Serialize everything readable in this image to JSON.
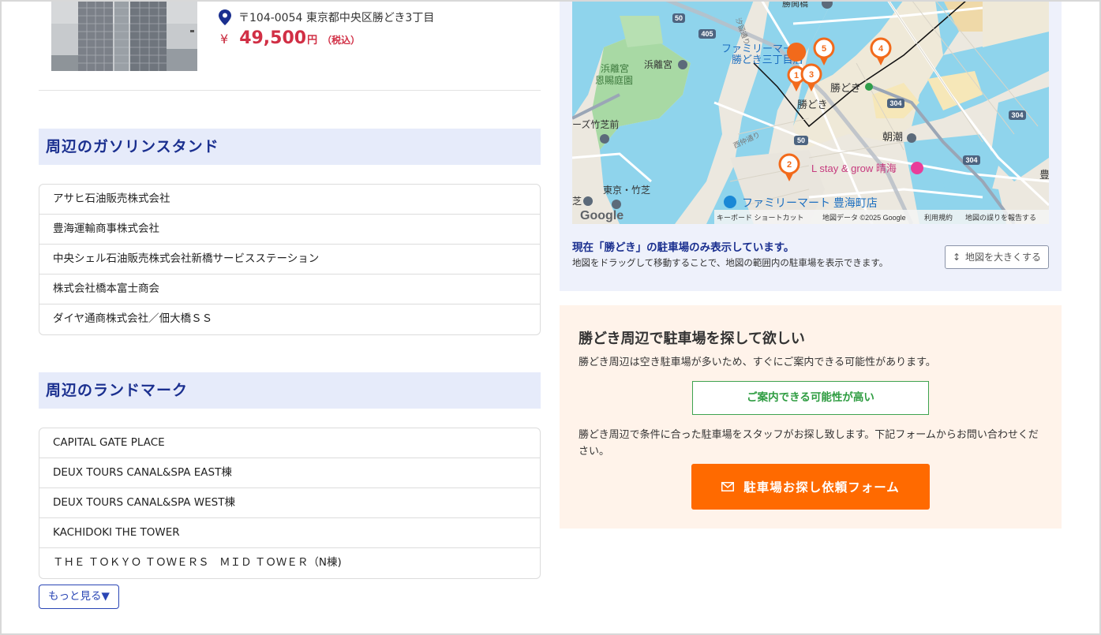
{
  "listing": {
    "address": "〒104-0054 東京都中央区勝どき3丁目",
    "yen_symbol": "¥",
    "price": "49,500",
    "price_unit": "円",
    "tax_note": "（税込）"
  },
  "gas_stations": {
    "heading": "周辺のガソリンスタンド",
    "items": [
      "アサヒ石油販売株式会社",
      "豊海運輸商事株式会社",
      "中央シェル石油販売株式会社新橋サービスステーション",
      "株式会社橋本富士商会",
      "ダイヤ通商株式会社／佃大橋ＳＳ"
    ]
  },
  "landmarks": {
    "heading": "周辺のランドマーク",
    "items": [
      "CAPITAL GATE PLACE",
      "DEUX TOURS CANAL&SPA EAST棟",
      "DEUX TOURS CANAL&SPA WEST棟",
      "KACHIDOKI THE TOWER",
      "ＴＨＥ ＴＯＫＹＯ ＴＯＷＥＲＳ　ＭＩＤ ＴＯＷＥＲ（N棟)"
    ],
    "more_label": "もっと見る▼"
  },
  "map": {
    "labels": {
      "hamarikyu": "浜離宮",
      "hamarikyu_garden_1": "浜離宮",
      "hamarikyu_garden_2": "恩賜庭園",
      "familymart_kachidoki_1": "ファミリーマート",
      "familymart_kachidoki_2": "勝どき三丁目店",
      "kachidoki_station": "勝どき",
      "kachidoki_area": "勝どき",
      "asashio": "朝潮",
      "takeshiba_mae": "ーズ竹芝前",
      "tokyo_takeshiba": "東京・竹芝",
      "lstay": "L stay & grow 晴海",
      "familymart_toyomi": "ファミリーマート 豊海町店",
      "kachidoki_bridge": "勝鬨橋",
      "shioji_road": "汐留通り",
      "nishinaka_road": "西仲通り",
      "shio": "芝",
      "toyo": "豊",
      "route_50a": "50",
      "route_50b": "50",
      "route_405": "405",
      "route_304a": "304",
      "route_304b": "304",
      "route_304c": "304"
    },
    "markers": [
      "1",
      "2",
      "3",
      "4",
      "5"
    ],
    "google_logo": "Google",
    "attribution": {
      "shortcuts": "キーボード ショートカット",
      "data": "地図データ ©2025 Google",
      "terms": "利用規約",
      "report": "地図の誤りを報告する"
    },
    "note_title": "現在「勝どき」の駐車場のみ表示しています。",
    "note_text": "地図をドラッグして移動することで、地図の範囲内の駐車場を表示できます。",
    "enlarge_label": "地図を大きくする",
    "colors": {
      "water": "#8fd4ec",
      "land": "#e9e5dd",
      "marker": "#f26a1b"
    }
  },
  "parking_search": {
    "title": "勝どき周辺で駐車場を探して欲しい",
    "description": "勝どき周辺は空き駐車場が多いため、すぐにご案内できる可能性があります。",
    "badge": "ご案内できる可能性が高い",
    "body": "勝どき周辺で条件に合った駐車場をスタッフがお探し致します。下記フォームからお問い合わせください。",
    "button_label": "駐車場お探し依頼フォーム",
    "colors": {
      "button": "#ff6a00",
      "badge": "#2e9c41"
    }
  }
}
